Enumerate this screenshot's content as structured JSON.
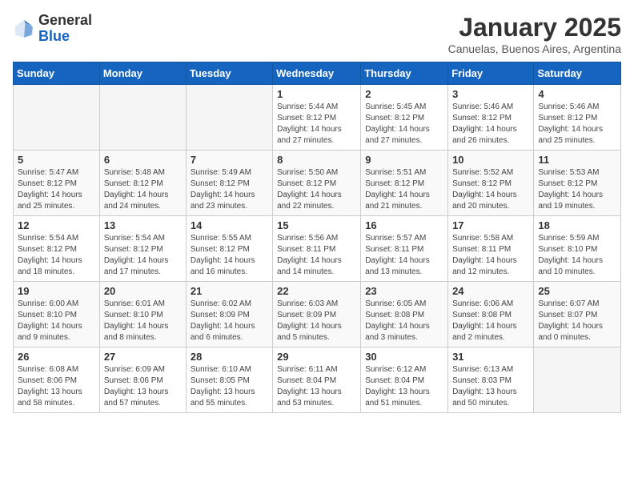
{
  "logo": {
    "general": "General",
    "blue": "Blue"
  },
  "title": "January 2025",
  "subtitle": "Canuelas, Buenos Aires, Argentina",
  "headers": [
    "Sunday",
    "Monday",
    "Tuesday",
    "Wednesday",
    "Thursday",
    "Friday",
    "Saturday"
  ],
  "weeks": [
    [
      {
        "num": "",
        "info": ""
      },
      {
        "num": "",
        "info": ""
      },
      {
        "num": "",
        "info": ""
      },
      {
        "num": "1",
        "info": "Sunrise: 5:44 AM\nSunset: 8:12 PM\nDaylight: 14 hours\nand 27 minutes."
      },
      {
        "num": "2",
        "info": "Sunrise: 5:45 AM\nSunset: 8:12 PM\nDaylight: 14 hours\nand 27 minutes."
      },
      {
        "num": "3",
        "info": "Sunrise: 5:46 AM\nSunset: 8:12 PM\nDaylight: 14 hours\nand 26 minutes."
      },
      {
        "num": "4",
        "info": "Sunrise: 5:46 AM\nSunset: 8:12 PM\nDaylight: 14 hours\nand 25 minutes."
      }
    ],
    [
      {
        "num": "5",
        "info": "Sunrise: 5:47 AM\nSunset: 8:12 PM\nDaylight: 14 hours\nand 25 minutes."
      },
      {
        "num": "6",
        "info": "Sunrise: 5:48 AM\nSunset: 8:12 PM\nDaylight: 14 hours\nand 24 minutes."
      },
      {
        "num": "7",
        "info": "Sunrise: 5:49 AM\nSunset: 8:12 PM\nDaylight: 14 hours\nand 23 minutes."
      },
      {
        "num": "8",
        "info": "Sunrise: 5:50 AM\nSunset: 8:12 PM\nDaylight: 14 hours\nand 22 minutes."
      },
      {
        "num": "9",
        "info": "Sunrise: 5:51 AM\nSunset: 8:12 PM\nDaylight: 14 hours\nand 21 minutes."
      },
      {
        "num": "10",
        "info": "Sunrise: 5:52 AM\nSunset: 8:12 PM\nDaylight: 14 hours\nand 20 minutes."
      },
      {
        "num": "11",
        "info": "Sunrise: 5:53 AM\nSunset: 8:12 PM\nDaylight: 14 hours\nand 19 minutes."
      }
    ],
    [
      {
        "num": "12",
        "info": "Sunrise: 5:54 AM\nSunset: 8:12 PM\nDaylight: 14 hours\nand 18 minutes."
      },
      {
        "num": "13",
        "info": "Sunrise: 5:54 AM\nSunset: 8:12 PM\nDaylight: 14 hours\nand 17 minutes."
      },
      {
        "num": "14",
        "info": "Sunrise: 5:55 AM\nSunset: 8:12 PM\nDaylight: 14 hours\nand 16 minutes."
      },
      {
        "num": "15",
        "info": "Sunrise: 5:56 AM\nSunset: 8:11 PM\nDaylight: 14 hours\nand 14 minutes."
      },
      {
        "num": "16",
        "info": "Sunrise: 5:57 AM\nSunset: 8:11 PM\nDaylight: 14 hours\nand 13 minutes."
      },
      {
        "num": "17",
        "info": "Sunrise: 5:58 AM\nSunset: 8:11 PM\nDaylight: 14 hours\nand 12 minutes."
      },
      {
        "num": "18",
        "info": "Sunrise: 5:59 AM\nSunset: 8:10 PM\nDaylight: 14 hours\nand 10 minutes."
      }
    ],
    [
      {
        "num": "19",
        "info": "Sunrise: 6:00 AM\nSunset: 8:10 PM\nDaylight: 14 hours\nand 9 minutes."
      },
      {
        "num": "20",
        "info": "Sunrise: 6:01 AM\nSunset: 8:10 PM\nDaylight: 14 hours\nand 8 minutes."
      },
      {
        "num": "21",
        "info": "Sunrise: 6:02 AM\nSunset: 8:09 PM\nDaylight: 14 hours\nand 6 minutes."
      },
      {
        "num": "22",
        "info": "Sunrise: 6:03 AM\nSunset: 8:09 PM\nDaylight: 14 hours\nand 5 minutes."
      },
      {
        "num": "23",
        "info": "Sunrise: 6:05 AM\nSunset: 8:08 PM\nDaylight: 14 hours\nand 3 minutes."
      },
      {
        "num": "24",
        "info": "Sunrise: 6:06 AM\nSunset: 8:08 PM\nDaylight: 14 hours\nand 2 minutes."
      },
      {
        "num": "25",
        "info": "Sunrise: 6:07 AM\nSunset: 8:07 PM\nDaylight: 14 hours\nand 0 minutes."
      }
    ],
    [
      {
        "num": "26",
        "info": "Sunrise: 6:08 AM\nSunset: 8:06 PM\nDaylight: 13 hours\nand 58 minutes."
      },
      {
        "num": "27",
        "info": "Sunrise: 6:09 AM\nSunset: 8:06 PM\nDaylight: 13 hours\nand 57 minutes."
      },
      {
        "num": "28",
        "info": "Sunrise: 6:10 AM\nSunset: 8:05 PM\nDaylight: 13 hours\nand 55 minutes."
      },
      {
        "num": "29",
        "info": "Sunrise: 6:11 AM\nSunset: 8:04 PM\nDaylight: 13 hours\nand 53 minutes."
      },
      {
        "num": "30",
        "info": "Sunrise: 6:12 AM\nSunset: 8:04 PM\nDaylight: 13 hours\nand 51 minutes."
      },
      {
        "num": "31",
        "info": "Sunrise: 6:13 AM\nSunset: 8:03 PM\nDaylight: 13 hours\nand 50 minutes."
      },
      {
        "num": "",
        "info": ""
      }
    ]
  ]
}
